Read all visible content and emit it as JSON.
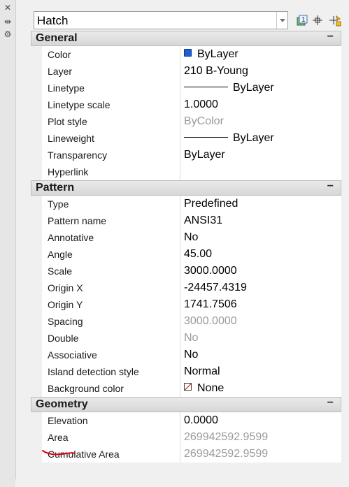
{
  "left_strip": {
    "icons": [
      "close-icon",
      "auto-hide-icon",
      "properties-menu-icon"
    ]
  },
  "topbar": {
    "object_type": "Hatch",
    "buttons": [
      "toggle-pickadd-icon",
      "select-objects-icon",
      "quick-select-icon"
    ]
  },
  "sections": {
    "general": {
      "title": "General",
      "toggle": "−",
      "rows": [
        {
          "label": "Color",
          "value": "ByLayer"
        },
        {
          "label": "Layer",
          "value": "210 B-Young"
        },
        {
          "label": "Linetype",
          "value": "ByLayer"
        },
        {
          "label": "Linetype scale",
          "value": "1.0000"
        },
        {
          "label": "Plot style",
          "value": "ByColor"
        },
        {
          "label": "Lineweight",
          "value": "ByLayer"
        },
        {
          "label": "Transparency",
          "value": "ByLayer"
        },
        {
          "label": "Hyperlink",
          "value": ""
        }
      ]
    },
    "pattern": {
      "title": "Pattern",
      "toggle": "−",
      "rows": [
        {
          "label": "Type",
          "value": "Predefined"
        },
        {
          "label": "Pattern name",
          "value": "ANSI31"
        },
        {
          "label": "Annotative",
          "value": "No"
        },
        {
          "label": "Angle",
          "value": "45.00"
        },
        {
          "label": "Scale",
          "value": "3000.0000"
        },
        {
          "label": "Origin X",
          "value": "-24457.4319"
        },
        {
          "label": "Origin Y",
          "value": "1741.7506"
        },
        {
          "label": "Spacing",
          "value": "3000.0000"
        },
        {
          "label": "Double",
          "value": "No"
        },
        {
          "label": "Associative",
          "value": "No"
        },
        {
          "label": "Island detection style",
          "value": "Normal"
        },
        {
          "label": "Background color",
          "value": "None"
        }
      ]
    },
    "geometry": {
      "title": "Geometry",
      "toggle": "−",
      "rows": [
        {
          "label": "Elevation",
          "value": "0.0000"
        },
        {
          "label": "Area",
          "value": "269942592.9599"
        },
        {
          "label": "Cumulative Area",
          "value": "269942592.9599"
        }
      ]
    }
  },
  "colors": {
    "color_swatch": "#1f5fd6",
    "annotation_underline": "#e0001b",
    "readonly_text": "#9a9a9a"
  }
}
